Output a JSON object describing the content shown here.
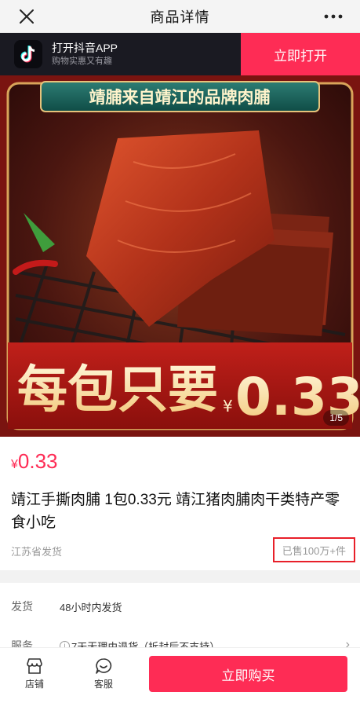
{
  "nav": {
    "title": "商品详情",
    "close_icon": "close-icon",
    "more_icon": "more-dots-icon"
  },
  "app_banner": {
    "name": "打开抖音APP",
    "slogan": "购物实惠又有趣",
    "open_label": "立即打开",
    "logo_icon": "tiktok-logo-icon"
  },
  "hero": {
    "headline": "靖脯来自靖江的品牌肉脯",
    "promo_text": "每包只要",
    "promo_currency": "¥",
    "promo_price": "0.33",
    "counter": "1/5"
  },
  "product": {
    "currency": "¥",
    "price": "0.33",
    "title": "靖江手撕肉脯 1包0.33元 靖江猪肉脯肉干类特产零食小吃",
    "ship_from": "江苏省发货",
    "sold": "已售100万+件"
  },
  "details": {
    "ship_label": "发货",
    "ship_value": "48小时内发货",
    "service_label": "服务",
    "service_value": "7天无理由退货（拆封后不支持）"
  },
  "bottom": {
    "store_label": "店铺",
    "service_label": "客服",
    "buy_label": "立即购买"
  },
  "colors": {
    "brand": "#fe2c55",
    "banner_bg": "#1a1a22",
    "highlight_box": "#e8202a"
  }
}
